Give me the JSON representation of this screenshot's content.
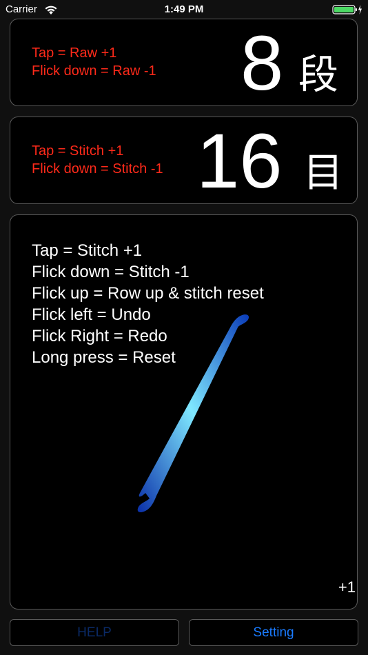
{
  "status_bar": {
    "carrier": "Carrier",
    "time": "1:49 PM",
    "battery_color": "#4cd964"
  },
  "row_counter": {
    "hint_tap": "Tap = Raw +1",
    "hint_flick": "Flick down = Raw -1",
    "value": "8",
    "unit": "段"
  },
  "stitch_counter": {
    "hint_tap": "Tap = Stitch +1",
    "hint_flick": "Flick down = Stitch -1",
    "value": "16",
    "unit": "目"
  },
  "help_panel": {
    "lines": [
      "Tap = Stitch +1",
      "Flick down = Stitch -1",
      "Flick up = Row up & stitch reset",
      "Flick left = Undo",
      "Flick Right = Redo",
      "Long press = Reset"
    ],
    "increment_label": "+1"
  },
  "buttons": {
    "help_label": "HELP",
    "setting_label": "Setting"
  },
  "colors": {
    "hint_red": "#ff2a1a",
    "accent_blue": "#1a7bff",
    "disabled_blue": "#0a2a66"
  }
}
